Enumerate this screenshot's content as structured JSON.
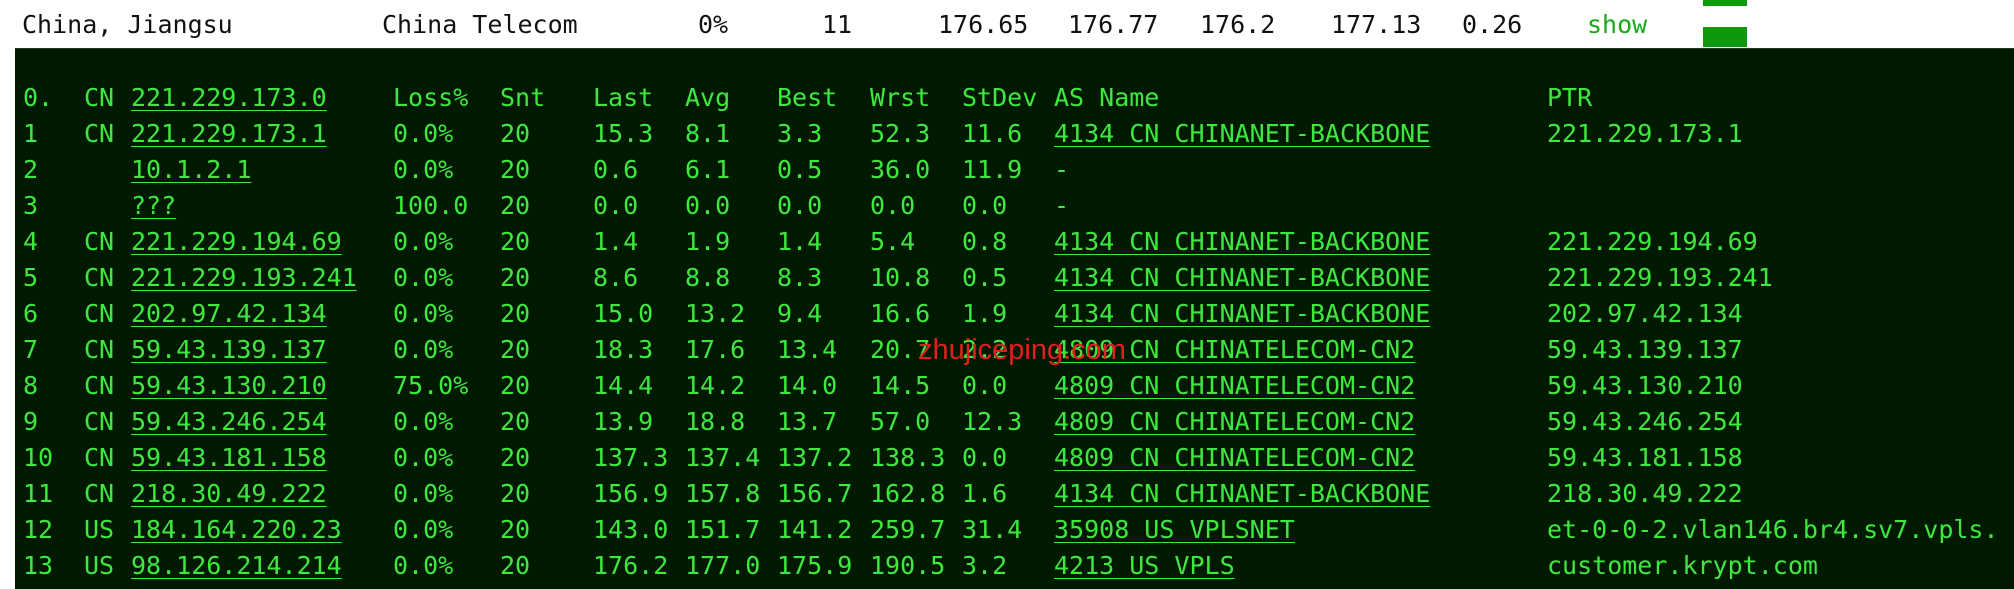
{
  "summary": {
    "location": "China, Jiangsu",
    "isp": "China Telecom",
    "loss": "0%",
    "count": "11",
    "v1": "176.65",
    "v2": "176.77",
    "v3": "176.2",
    "v4": "177.13",
    "v5": "0.26",
    "show_label": "show"
  },
  "colors": {
    "terminal_bg": "#001a00",
    "terminal_text": "#3ee83e",
    "watermark": "#e0201f",
    "bar": "#0b9a0b"
  },
  "header": {
    "hop": "0.",
    "cc": "CN",
    "host": "221.229.173.0",
    "loss": "Loss%",
    "snt": "Snt",
    "last": "Last",
    "avg": "Avg",
    "best": "Best",
    "wrst": "Wrst",
    "stdev": "StDev",
    "asname": "AS Name",
    "ptr": "PTR"
  },
  "hops": [
    {
      "hop": "1",
      "cc": "CN",
      "host": "221.229.173.1",
      "loss": "0.0%",
      "snt": "20",
      "last": "15.3",
      "avg": "8.1",
      "best": "3.3",
      "wrst": "52.3",
      "stdev": "11.6",
      "asname": "4134  CN CHINANET-BACKBONE",
      "ptr": "221.229.173.1"
    },
    {
      "hop": "2",
      "cc": "",
      "host": "10.1.2.1",
      "loss": "0.0%",
      "snt": "20",
      "last": "0.6",
      "avg": "6.1",
      "best": "0.5",
      "wrst": "36.0",
      "stdev": "11.9",
      "asname": "-",
      "ptr": ""
    },
    {
      "hop": "3",
      "cc": "",
      "host": "???",
      "loss": "100.0",
      "snt": "20",
      "last": "0.0",
      "avg": "0.0",
      "best": "0.0",
      "wrst": "0.0",
      "stdev": "0.0",
      "asname": "-",
      "ptr": ""
    },
    {
      "hop": "4",
      "cc": "CN",
      "host": "221.229.194.69",
      "loss": "0.0%",
      "snt": "20",
      "last": "1.4",
      "avg": "1.9",
      "best": "1.4",
      "wrst": "5.4",
      "stdev": "0.8",
      "asname": "4134  CN CHINANET-BACKBONE",
      "ptr": "221.229.194.69"
    },
    {
      "hop": "5",
      "cc": "CN",
      "host": "221.229.193.241",
      "loss": "0.0%",
      "snt": "20",
      "last": "8.6",
      "avg": "8.8",
      "best": "8.3",
      "wrst": "10.8",
      "stdev": "0.5",
      "asname": "4134  CN CHINANET-BACKBONE",
      "ptr": "221.229.193.241"
    },
    {
      "hop": "6",
      "cc": "CN",
      "host": "202.97.42.134",
      "loss": "0.0%",
      "snt": "20",
      "last": "15.0",
      "avg": "13.2",
      "best": "9.4",
      "wrst": "16.6",
      "stdev": "1.9",
      "asname": "4134  CN CHINANET-BACKBONE",
      "ptr": "202.97.42.134"
    },
    {
      "hop": "7",
      "cc": "CN",
      "host": "59.43.139.137",
      "loss": "0.0%",
      "snt": "20",
      "last": "18.3",
      "avg": "17.6",
      "best": "13.4",
      "wrst": "20.7",
      "stdev": "2.2",
      "asname": "4809  CN CHINATELECOM-CN2",
      "ptr": "59.43.139.137"
    },
    {
      "hop": "8",
      "cc": "CN",
      "host": "59.43.130.210",
      "loss": "75.0%",
      "snt": "20",
      "last": "14.4",
      "avg": "14.2",
      "best": "14.0",
      "wrst": "14.5",
      "stdev": "0.0",
      "asname": "4809  CN CHINATELECOM-CN2",
      "ptr": "59.43.130.210"
    },
    {
      "hop": "9",
      "cc": "CN",
      "host": "59.43.246.254",
      "loss": "0.0%",
      "snt": "20",
      "last": "13.9",
      "avg": "18.8",
      "best": "13.7",
      "wrst": "57.0",
      "stdev": "12.3",
      "asname": "4809  CN CHINATELECOM-CN2",
      "ptr": "59.43.246.254"
    },
    {
      "hop": "10",
      "cc": "CN",
      "host": "59.43.181.158",
      "loss": "0.0%",
      "snt": "20",
      "last": "137.3",
      "avg": "137.4",
      "best": "137.2",
      "wrst": "138.3",
      "stdev": "0.0",
      "asname": "4809  CN CHINATELECOM-CN2",
      "ptr": "59.43.181.158"
    },
    {
      "hop": "11",
      "cc": "CN",
      "host": "218.30.49.222",
      "loss": "0.0%",
      "snt": "20",
      "last": "156.9",
      "avg": "157.8",
      "best": "156.7",
      "wrst": "162.8",
      "stdev": "1.6",
      "asname": "4134  CN CHINANET-BACKBONE",
      "ptr": "218.30.49.222"
    },
    {
      "hop": "12",
      "cc": "US",
      "host": "184.164.220.23",
      "loss": "0.0%",
      "snt": "20",
      "last": "143.0",
      "avg": "151.7",
      "best": "141.2",
      "wrst": "259.7",
      "stdev": "31.4",
      "asname": "35908 US VPLSNET",
      "ptr": "et-0-0-2.vlan146.br4.sv7.vpls."
    },
    {
      "hop": "13",
      "cc": "US",
      "host": "98.126.214.214",
      "loss": "0.0%",
      "snt": "20",
      "last": "176.2",
      "avg": "177.0",
      "best": "175.9",
      "wrst": "190.5",
      "stdev": "3.2",
      "asname": "4213  US VPLS",
      "ptr": "customer.krypt.com"
    }
  ],
  "watermark": "zhujiceping.com"
}
